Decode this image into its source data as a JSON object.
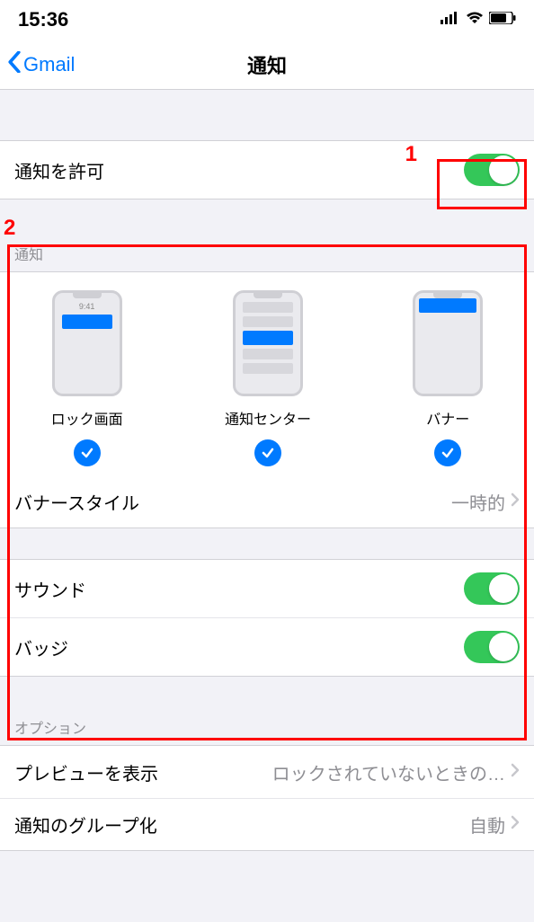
{
  "statusBar": {
    "time": "15:36"
  },
  "nav": {
    "back": "Gmail",
    "title": "通知"
  },
  "allowNotifications": {
    "label": "通知を許可",
    "on": true
  },
  "alertsSection": {
    "header": "通知",
    "lockScreen": {
      "label": "ロック画面",
      "previewTime": "9:41",
      "checked": true
    },
    "notificationCenter": {
      "label": "通知センター",
      "checked": true
    },
    "banners": {
      "label": "バナー",
      "checked": true
    },
    "bannerStyle": {
      "label": "バナースタイル",
      "value": "一時的"
    }
  },
  "sounds": {
    "label": "サウンド",
    "on": true
  },
  "badges": {
    "label": "バッジ",
    "on": true
  },
  "optionsSection": {
    "header": "オプション",
    "showPreviews": {
      "label": "プレビューを表示",
      "value": "ロックされていないときの…"
    },
    "grouping": {
      "label": "通知のグループ化",
      "value": "自動"
    }
  },
  "annotations": {
    "one": "1",
    "two": "2"
  },
  "colors": {
    "accent": "#007aff",
    "toggleOn": "#34c759"
  }
}
